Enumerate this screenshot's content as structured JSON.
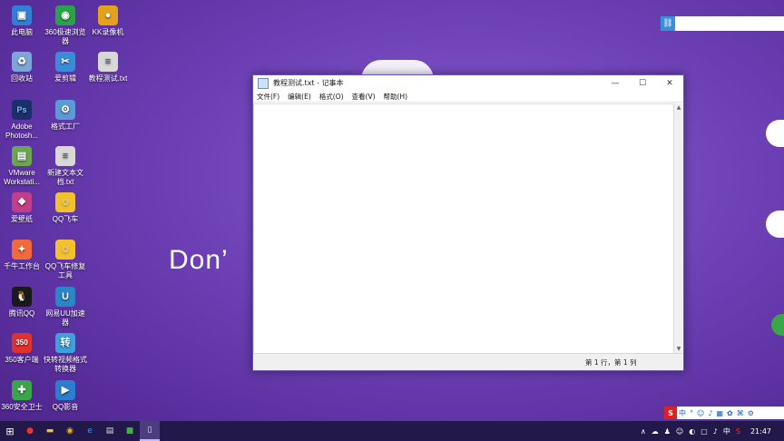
{
  "wallpaper": {
    "text": "Don’"
  },
  "desktop_icons": [
    {
      "label": "此电脑",
      "color": "#2f7fd6",
      "glyph": "▣"
    },
    {
      "label": "360极速浏览器",
      "color": "#2aa24a",
      "glyph": "◉"
    },
    {
      "label": "KK录像机",
      "color": "#e4a11b",
      "glyph": "●"
    },
    {
      "label": "回收站",
      "color": "#7ba6d8",
      "glyph": "♻"
    },
    {
      "label": "爱剪辑",
      "color": "#3a8bd8",
      "glyph": "✂"
    },
    {
      "label": "教程测试.txt",
      "color": "#d8d8d8",
      "glyph": "≡"
    },
    {
      "label": "Adobe Photosh...",
      "color": "#1b2f6b",
      "glyph": "Ps"
    },
    {
      "label": "格式工厂",
      "color": "#5a9ad9",
      "glyph": "⚙"
    },
    {
      "label": "VMware Workstati...",
      "color": "#6aa84f",
      "glyph": "▤"
    },
    {
      "label": "新建文本文档.txt",
      "color": "#d8d8d8",
      "glyph": "≡"
    },
    {
      "label": "爱壁纸",
      "color": "#c33e8a",
      "glyph": "❖"
    },
    {
      "label": "QQ飞车",
      "color": "#f2c12e",
      "glyph": "☺"
    },
    {
      "label": "千牛工作台",
      "color": "#f06a3a",
      "glyph": "✦"
    },
    {
      "label": "QQ飞车修复工具",
      "color": "#f2c12e",
      "glyph": "☺"
    },
    {
      "label": "腾讯QQ",
      "color": "#1a1a1a",
      "glyph": "🐧"
    },
    {
      "label": "网易UU加速器",
      "color": "#2b86c8",
      "glyph": "U"
    },
    {
      "label": "350客户端",
      "color": "#e03030",
      "glyph": "350"
    },
    {
      "label": "快转视频格式转换器",
      "color": "#3da1e0",
      "glyph": "转"
    },
    {
      "label": "360安全卫士",
      "color": "#3aa64a",
      "glyph": "✚"
    },
    {
      "label": "QQ影音",
      "color": "#2b7fd0",
      "glyph": "▶"
    }
  ],
  "notepad": {
    "title": "教程测试.txt - 记事本",
    "menus": [
      "文件(F)",
      "编辑(E)",
      "格式(O)",
      "查看(V)",
      "帮助(H)"
    ],
    "status_position": "第 1 行，第 1 列",
    "controls": {
      "minimize": "—",
      "maximize": "☐",
      "close": "✕"
    }
  },
  "ime_bar": {
    "logo": "S",
    "items": [
      "中",
      "°",
      "☺",
      "♪",
      "▦",
      "✿",
      "⌘",
      "⚙"
    ]
  },
  "taskbar": {
    "start_glyph": "⊞",
    "time": "21:47",
    "tray_input": "中",
    "tray_icons": [
      "∧",
      "☁",
      "♟",
      "☺",
      "◐",
      "▢",
      "♪",
      "S"
    ]
  }
}
